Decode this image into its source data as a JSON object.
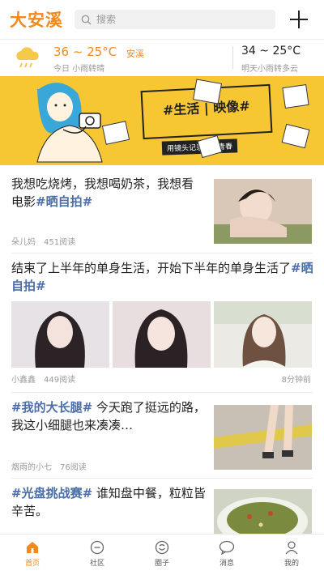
{
  "header": {
    "logo": "大安溪",
    "search_placeholder": "搜索"
  },
  "weather": {
    "today_temp": "36 ~ 25°C",
    "today_place": "安溪",
    "today_desc": "今日 小雨转晴",
    "tomorrow_temp": "34 ~ 25°C",
    "tomorrow_desc": "明天小雨转多云"
  },
  "banner": {
    "title": "#生活 | 映像#",
    "subtitle": "用镜头记录整个青春"
  },
  "feed": [
    {
      "text": "我想吃烧烤，我想喝奶茶，我想看电影",
      "tag": "#晒自拍#",
      "author": "朵儿妈",
      "reads": "451阅读"
    },
    {
      "text": "结束了上半年的单身生活，开始下半年的单身生活了",
      "tag": "#晒自拍#",
      "author": "小鑫鑫",
      "reads": "449阅读",
      "time": "8分钟前"
    },
    {
      "tag": "#我的大长腿#",
      "text": " 今天跑了挺远的路，我这小细腿也来凑凑…",
      "author": "烟雨的小七",
      "reads": "76阅读"
    },
    {
      "tag": "#光盘挑战赛#",
      "text": " 谁知盘中餐，粒粒皆辛苦。"
    }
  ],
  "nav": [
    {
      "label": "首页",
      "icon": "home-icon",
      "active": true
    },
    {
      "label": "社区",
      "icon": "community-icon"
    },
    {
      "label": "圈子",
      "icon": "circle-icon"
    },
    {
      "label": "消息",
      "icon": "message-icon"
    },
    {
      "label": "我的",
      "icon": "profile-icon"
    }
  ],
  "colors": {
    "accent": "#f08a1c",
    "tag": "#4b6ea8",
    "banner": "#f7c733"
  }
}
